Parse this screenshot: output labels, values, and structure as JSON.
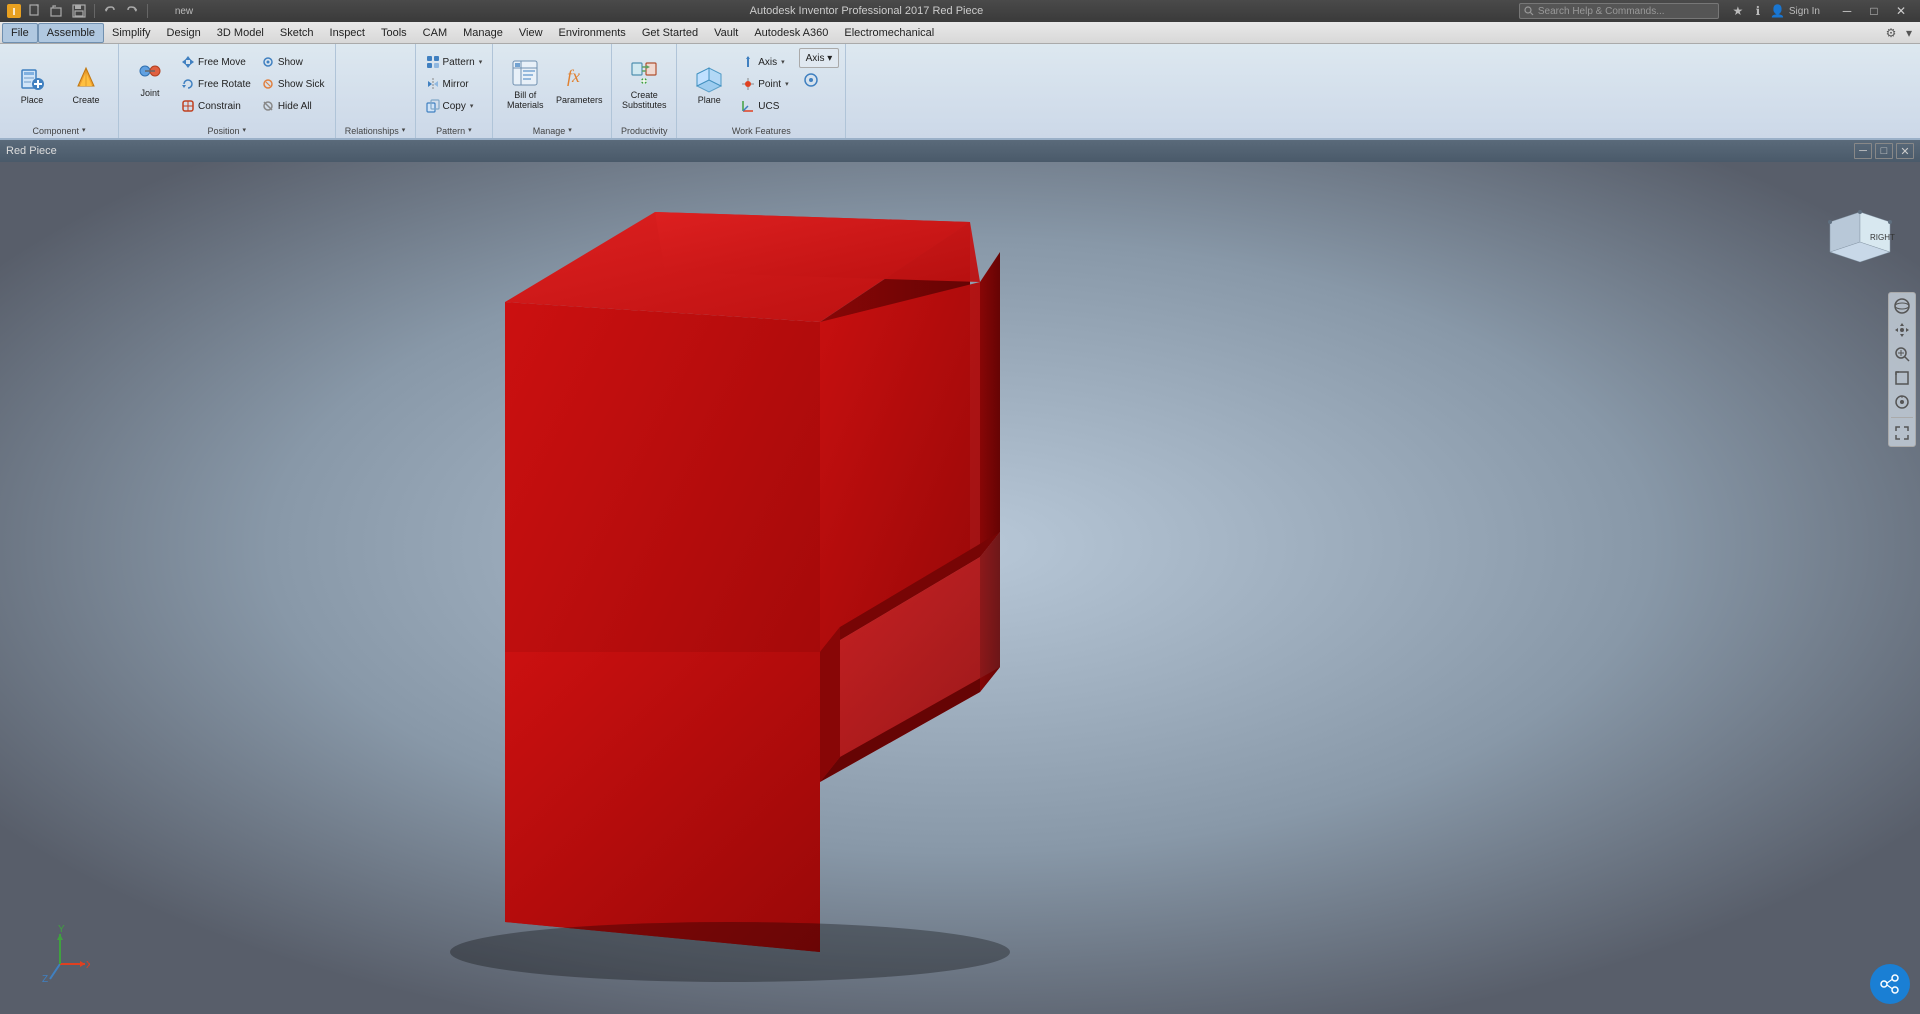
{
  "titlebar": {
    "app_name": "Autodesk Inventor Professional 2017",
    "document_name": "Red Piece",
    "full_title": "Autodesk Inventor Professional 2017  Red Piece",
    "search_placeholder": "Search Help & Commands...",
    "sign_in": "Sign In",
    "quick_access": [
      "new",
      "open",
      "save",
      "undo",
      "redo",
      "help"
    ]
  },
  "menubar": {
    "items": [
      {
        "id": "file",
        "label": "File"
      },
      {
        "id": "assemble",
        "label": "Assemble",
        "active": true
      },
      {
        "id": "simplify",
        "label": "Simplify"
      },
      {
        "id": "design",
        "label": "Design"
      },
      {
        "id": "3dmodel",
        "label": "3D Model"
      },
      {
        "id": "sketch",
        "label": "Sketch"
      },
      {
        "id": "inspect",
        "label": "Inspect"
      },
      {
        "id": "tools",
        "label": "Tools"
      },
      {
        "id": "cam",
        "label": "CAM"
      },
      {
        "id": "manage",
        "label": "Manage"
      },
      {
        "id": "view",
        "label": "View"
      },
      {
        "id": "environments",
        "label": "Environments"
      },
      {
        "id": "getstarted",
        "label": "Get Started"
      },
      {
        "id": "vault",
        "label": "Vault"
      },
      {
        "id": "a360",
        "label": "Autodesk A360"
      },
      {
        "id": "electromechanical",
        "label": "Electromechanical"
      }
    ]
  },
  "ribbon": {
    "groups": [
      {
        "id": "component",
        "label": "Component",
        "has_dropdown": true,
        "buttons_large": [
          {
            "id": "place",
            "label": "Place",
            "icon": "place"
          },
          {
            "id": "create",
            "label": "Create",
            "icon": "create"
          }
        ],
        "buttons_small": []
      },
      {
        "id": "position",
        "label": "Position",
        "has_dropdown": true,
        "buttons_large": [],
        "buttons_small": [
          {
            "id": "free-move",
            "label": "Free Move",
            "icon": "free-move"
          },
          {
            "id": "free-rotate",
            "label": "Free Rotate",
            "icon": "free-rotate"
          },
          {
            "id": "joint",
            "label": "Joint",
            "icon": "joint"
          },
          {
            "id": "constrain",
            "label": "Constrain",
            "icon": "constrain"
          },
          {
            "id": "show",
            "label": "Show",
            "icon": "show"
          },
          {
            "id": "show-sick",
            "label": "Show Sick",
            "icon": "show-sick"
          },
          {
            "id": "hide-all",
            "label": "Hide All",
            "icon": "hide-all"
          }
        ]
      },
      {
        "id": "relationships",
        "label": "Relationships",
        "has_dropdown": true,
        "buttons_large": [],
        "buttons_small": []
      },
      {
        "id": "pattern",
        "label": "Pattern",
        "has_dropdown": true,
        "buttons_small": [
          {
            "id": "pattern",
            "label": "Pattern",
            "icon": "pattern"
          },
          {
            "id": "mirror",
            "label": "Mirror",
            "icon": "mirror"
          },
          {
            "id": "copy",
            "label": "Copy",
            "icon": "copy"
          }
        ]
      },
      {
        "id": "manage",
        "label": "Manage",
        "has_dropdown": true,
        "buttons_large": [
          {
            "id": "bill-of-materials",
            "label": "Bill of\nMaterials",
            "icon": "bom"
          },
          {
            "id": "parameters",
            "label": "Parameters",
            "icon": "parameters"
          }
        ]
      },
      {
        "id": "productivity",
        "label": "Productivity",
        "buttons_large": [
          {
            "id": "create-substitutes",
            "label": "Create\nSubstitutes",
            "icon": "create-substitutes"
          }
        ]
      },
      {
        "id": "work-features",
        "label": "Work Features",
        "buttons_large": [
          {
            "id": "plane",
            "label": "Plane",
            "icon": "plane"
          }
        ],
        "buttons_small": [
          {
            "id": "axis",
            "label": "Axis",
            "icon": "axis",
            "has_dropdown": true
          },
          {
            "id": "point",
            "label": "Point",
            "icon": "point",
            "has_dropdown": true
          },
          {
            "id": "ucs",
            "label": "UCS",
            "icon": "ucs"
          }
        ]
      }
    ]
  },
  "viewport": {
    "title": "Red Piece",
    "background_colors": {
      "top": "#b8c8d8",
      "bottom": "#606878"
    },
    "nav_cube": {
      "label": "RIGHT"
    }
  },
  "statusbar": {
    "model_label": "Red Piece"
  },
  "colors": {
    "accent_blue": "#1a7fd4",
    "ribbon_bg": "#dde8f0",
    "titlebar_bg": "#3a3a3a",
    "menubar_active": "#b0c8e0",
    "red_piece": "#cc0000",
    "red_piece_dark": "#8b0000",
    "red_piece_mid": "#aa0000"
  }
}
